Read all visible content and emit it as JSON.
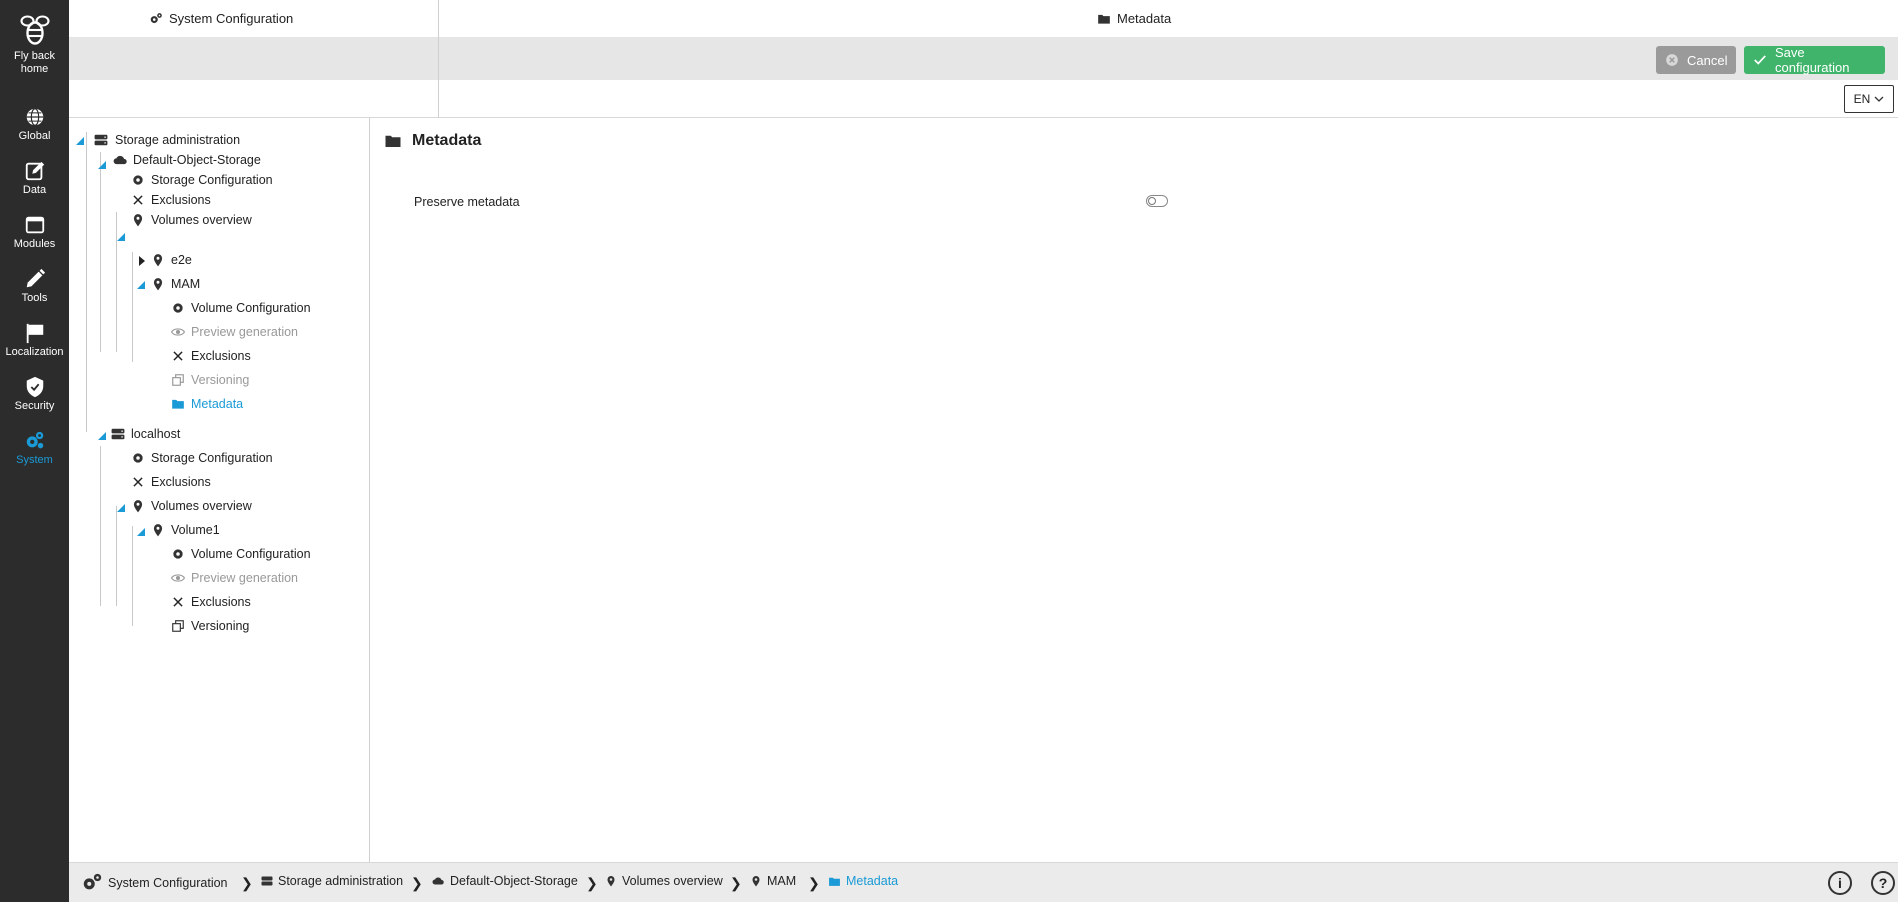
{
  "nav": {
    "items": [
      {
        "label": "Fly back home",
        "icon": "bee-logo-icon"
      },
      {
        "label": "Global",
        "icon": "globe-icon"
      },
      {
        "label": "Data",
        "icon": "edit-square-icon"
      },
      {
        "label": "Modules",
        "icon": "window-icon"
      },
      {
        "label": "Tools",
        "icon": "pencil-icon"
      },
      {
        "label": "Localization",
        "icon": "flag-icon"
      },
      {
        "label": "Security",
        "icon": "shield-icon"
      },
      {
        "label": "System",
        "icon": "gears-icon"
      }
    ],
    "active": "System"
  },
  "topbar": {
    "left_title": "System Configuration",
    "right_title": "Metadata"
  },
  "toolbar": {
    "cancel_label": "Cancel",
    "save_label": "Save configuration"
  },
  "lang": {
    "value": "EN"
  },
  "tree": {
    "storage_admin": "Storage administration",
    "default_object_storage": "Default-Object-Storage",
    "dos_storage_config": "Storage Configuration",
    "dos_exclusions": "Exclusions",
    "dos_volumes_overview": "Volumes overview",
    "e2e": "e2e",
    "mam": "MAM",
    "mam_volume_config": "Volume Configuration",
    "mam_preview": "Preview generation",
    "mam_exclusions": "Exclusions",
    "mam_versioning": "Versioning",
    "mam_metadata": "Metadata",
    "localhost": "localhost",
    "lh_storage_config": "Storage Configuration",
    "lh_exclusions": "Exclusions",
    "lh_volumes_overview": "Volumes overview",
    "volume1": "Volume1",
    "v1_volume_config": "Volume Configuration",
    "v1_preview": "Preview generation",
    "v1_exclusions": "Exclusions",
    "v1_versioning": "Versioning"
  },
  "content": {
    "title": "Metadata",
    "preserve_label": "Preserve metadata",
    "preserve_value": "off"
  },
  "breadcrumb": {
    "items": [
      "System Configuration",
      "Storage administration",
      "Default-Object-Storage",
      "Volumes overview",
      "MAM",
      "Metadata"
    ]
  },
  "colors": {
    "accent": "#1a9ad6",
    "save": "#3fb46a",
    "cancel": "#9a9a9a",
    "sidebar": "#2c2c2c"
  }
}
